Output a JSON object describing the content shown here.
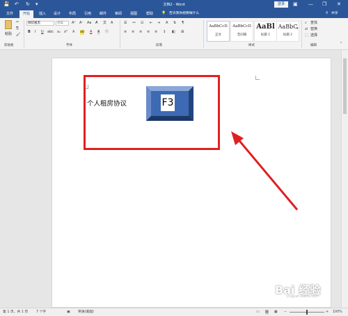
{
  "titlebar": {
    "title": "文档2 - Word",
    "signin": "登录",
    "save_icon": "💾",
    "undo_icon": "↶",
    "redo_icon": "↻",
    "qa_more": "▾",
    "ribbon_opts": "▣",
    "minimize": "—",
    "restore": "❐",
    "close": "✕"
  },
  "tabs": [
    {
      "label": "文件"
    },
    {
      "label": "开始",
      "active": true
    },
    {
      "label": "插入"
    },
    {
      "label": "设计"
    },
    {
      "label": "布局"
    },
    {
      "label": "引用"
    },
    {
      "label": "邮件"
    },
    {
      "label": "审阅"
    },
    {
      "label": "视图"
    },
    {
      "label": "帮助"
    }
  ],
  "tell_me": "告诉我你想要做什么",
  "share": "共享",
  "ribbon": {
    "paste_label": "粘贴",
    "clipboard_label": "剪贴板",
    "font_label": "字体",
    "paragraph_label": "段落",
    "styles_label": "样式",
    "editing_label": "编辑",
    "font_name": "微软雅黑",
    "font_size": "小三",
    "bold": "B",
    "italic": "I",
    "underline": "U",
    "find": "查找",
    "replace": "替换",
    "select": "选择",
    "styles": [
      {
        "preview": "AaBbCcD",
        "name": "正文"
      },
      {
        "preview": "AaBbCcD",
        "name": "无间隔"
      },
      {
        "preview": "AaBl",
        "name": "标题 1"
      },
      {
        "preview": "AaBbC",
        "name": "标题 2"
      }
    ]
  },
  "document": {
    "text": "个人租房协议",
    "key_label": "F3"
  },
  "statusbar": {
    "page": "第 1 页，共 1 页",
    "words": "7 个字",
    "language": "英语(美国)",
    "zoom": "100%"
  },
  "watermark": {
    "text": "Bai 经验",
    "sub": "jingyan.baidu.com"
  },
  "colors": {
    "word_blue": "#2b579a",
    "highlight_red": "#e02020",
    "key_blue": "#3e6ab4"
  }
}
